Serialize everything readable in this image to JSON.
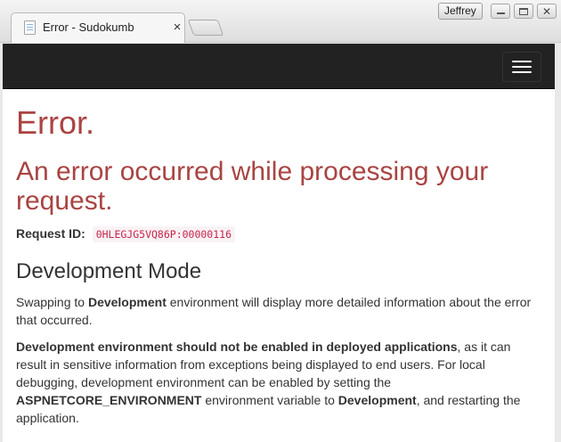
{
  "browser": {
    "tab_title": "Error - Sudokumb",
    "tab_close": "×",
    "profile_name": "Jeffrey",
    "close_glyph": "✕"
  },
  "page": {
    "title": "Error.",
    "subtitle": "An error occurred while processing your request.",
    "request_id_label": "Request ID:",
    "request_id_value": "0HLEGJG5VQ86P:00000116",
    "dev_heading": "Development Mode",
    "p1_a": "Swapping to ",
    "p1_b": "Development",
    "p1_c": " environment will display more detailed information about the error that occurred.",
    "p2_a": "Development environment should not be enabled in deployed applications",
    "p2_b": ", as it can result in sensitive information from exceptions being displayed to end users. For local debugging, development environment can be enabled by setting the ",
    "p2_c": "ASPNETCORE_ENVIRONMENT",
    "p2_d": " environment variable to ",
    "p2_e": "Development",
    "p2_f": ", and restarting the application."
  },
  "icons": {
    "favicon": "page-icon",
    "menu": "hamburger-icon"
  }
}
